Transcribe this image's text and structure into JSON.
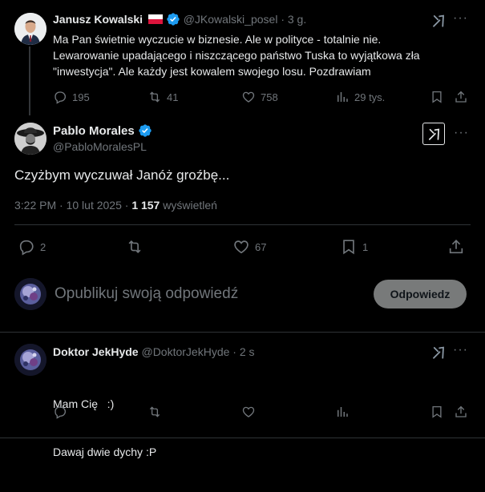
{
  "tweet1": {
    "author_name": "Janusz Kowalski",
    "flag_icon": "poland-flag-icon",
    "handle": "@JKowalski_posel",
    "time": "· 3 g.",
    "lines": [
      "Ma Pan świetnie wyczucie w biznesie. Ale w polityce - totalnie nie.",
      "Lewarowanie upadającego i niszczącego państwo Tuska to wyjątkowa zła",
      "\"inwestycja\". Ale każdy jest kowalem swojego losu. Pozdrawiam"
    ],
    "replies": "195",
    "reposts": "41",
    "likes": "758",
    "views": "29 tys."
  },
  "tweet2": {
    "author_name": "Pablo Morales",
    "handle": "@PabloMoralesPL",
    "text": "Czyżbym wyczuwał Janóż groźbę...",
    "timestamp": "3:22 PM · 10 lut 2025 · ",
    "views_count": "1 157",
    "views_label": " wyświetleń",
    "replies": "2",
    "likes": "67",
    "bookmarks": "1"
  },
  "composer": {
    "placeholder": "Opublikuj swoją odpowiedź",
    "reply_button": "Odpowiedz"
  },
  "tweet3": {
    "author_name": "Doktor JekHyde",
    "handle": "@DoktorJekHyde",
    "time": "· 2 s",
    "lines": [
      "Mam Cię   :)",
      "Dawaj dwie dychy :P"
    ]
  },
  "colors": {
    "background": "#000000",
    "text": "#e7e9ea",
    "muted": "#71767b",
    "verified": "#1d9bf0",
    "divider": "#2f3336",
    "reply_button_bg": "#787a7a"
  }
}
